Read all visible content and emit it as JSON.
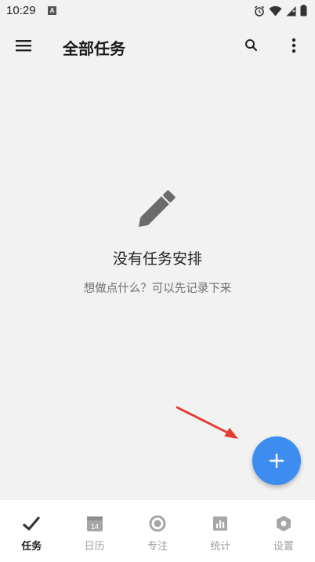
{
  "status_bar": {
    "time": "10:29",
    "a_badge": "A"
  },
  "app_bar": {
    "title": "全部任务",
    "menu_icon": "menu-icon",
    "search_icon": "search-icon",
    "more_icon": "more-vert-icon"
  },
  "empty_state": {
    "icon": "pencil-icon",
    "title": "没有任务安排",
    "subtitle": "想做点什么？可以先记录下来"
  },
  "fab": {
    "icon": "plus-icon",
    "color": "#3d8df0"
  },
  "annotation": {
    "arrow_color": "#e53a2e"
  },
  "calendar_day": "14",
  "bottom_nav": {
    "items": [
      {
        "label": "任务",
        "icon": "check-icon",
        "active": true
      },
      {
        "label": "日历",
        "icon": "calendar-icon",
        "active": false
      },
      {
        "label": "专注",
        "icon": "focus-icon",
        "active": false
      },
      {
        "label": "统计",
        "icon": "stats-icon",
        "active": false
      },
      {
        "label": "设置",
        "icon": "settings-icon",
        "active": false
      }
    ]
  }
}
